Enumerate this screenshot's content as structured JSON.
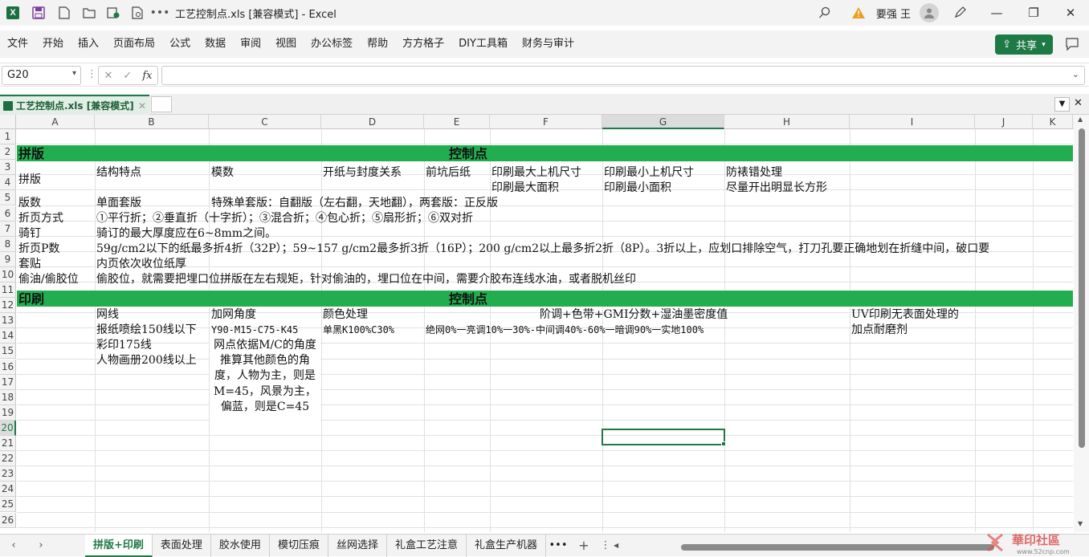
{
  "window": {
    "title": "工艺控制点.xls  [兼容模式]  -  Excel",
    "user": "要强 王"
  },
  "menu": [
    "文件",
    "开始",
    "插入",
    "页面布局",
    "公式",
    "数据",
    "审阅",
    "视图",
    "办公标签",
    "帮助",
    "方方格子",
    "DIY工具箱",
    "财务与审计"
  ],
  "share_label": "共享",
  "namebox": "G20",
  "fx_label": "fx",
  "doc_tab": "工艺控制点.xls  [兼容模式]",
  "columns": [
    "A",
    "B",
    "C",
    "D",
    "E",
    "F",
    "G",
    "H",
    "I",
    "J",
    "K"
  ],
  "rows": [
    "1",
    "2",
    "3",
    "4",
    "5",
    "6",
    "7",
    "8",
    "9",
    "10",
    "11",
    "12",
    "13",
    "14",
    "15",
    "16",
    "17",
    "18",
    "19",
    "20",
    "21",
    "22",
    "23",
    "24",
    "25",
    "26"
  ],
  "cells": {
    "r2a": "拼版",
    "r2ctl": "控制点",
    "r3a": "拼版",
    "r3b": "结构特点",
    "r3c": "模数",
    "r3d": "开纸与封度关系",
    "r3e": "前坑后纸",
    "r3f": "印刷最大上机尺寸",
    "r3g": "印刷最小上机尺寸",
    "r3h": "防裱错处理",
    "r4f": "印刷最大面积",
    "r4g": "印刷最小面积",
    "r4h": "尽量开出明显长方形",
    "r5a": "版数",
    "r5b": "单面套版",
    "r5c": "特殊单套版：自翻版（左右翻，天地翻），两套版：正反版",
    "r6a": "折页方式",
    "r6b": "①平行折；②垂直折（十字折）；③混合折；④包心折；⑤扇形折；⑥双对折",
    "r7a": "骑钉",
    "r7b": "骑订的最大厚度应在6~8mm之间。",
    "r8a": "折页P数",
    "r8b": " 59g/cm2以下的纸最多折4折（32P）；59~157 g/cm2最多折3折（16P）；200 g/cm2以上最多折2折（8P）。3折以上，应划口排除空气，打刀孔要正确地划在折缝中间，破口要",
    "r9a": "套贴",
    "r9b": "内页依次收位纸厚",
    "r10a": "偷油/偷胶位",
    "r10b": "偷胶位，就需要把埋口位拼版在左右规矩，针对偷油的，埋口位在中间，需要介胶布连线水油，或者脱机丝印",
    "r11a": "印刷",
    "r11ctl": "控制点",
    "r12b": "网线",
    "r12c": "加网角度",
    "r12d": "颜色处理",
    "r12f": "阶调+色带+GMI分数+湿油墨密度值",
    "r12i": "UV印刷无表面处理的",
    "r13b": "报纸喷绘150线以下",
    "r13c": "Y90-M15-C75-K45",
    "r13d": "单黑K100%C30%",
    "r13e": "绝网0%一亮调10%一30%-中间调40%-60%一暗调90%一实地100%",
    "r13i": "加点耐磨剂",
    "r14b": "彩印175线",
    "r14c": "网点依据M/C的角度推算其他颜色的角度，人物为主，则是M=45，风景为主，偏蓝，则是C=45",
    "r15b": "人物画册200线以上"
  },
  "sheets": [
    "拼版+印刷",
    "表面处理",
    "胶水使用",
    "模切压痕",
    "丝网选择",
    "礼盒工艺注意",
    "礼盒生产机器"
  ],
  "colors": {
    "accent": "#1d7a45",
    "header_green": "#22ae4f"
  }
}
